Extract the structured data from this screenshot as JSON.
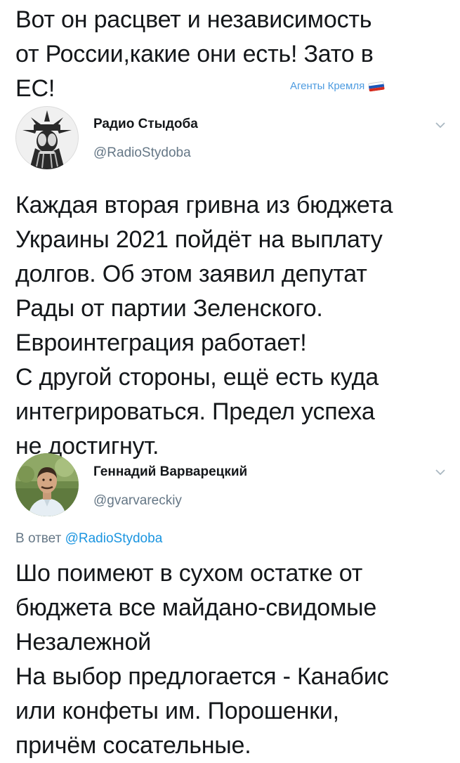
{
  "caption": "Вот он расцвет и независимость\nот России,какие они есть! Зато в\nЕС!",
  "watermark": {
    "text": "Агенты Кремля",
    "flag_colors": [
      "#ffffff",
      "#1c57b8",
      "#d52b1e"
    ]
  },
  "tweet1": {
    "author_name": "Радио Стыдоба",
    "handle": "@RadioStydoba",
    "text": "Каждая вторая гривна из бюджета\nУкраины 2021 пойдёт на выплату\nдолгов. Об этом заявил депутат\nРады от партии Зеленского.\nЕвроинтеграция работает!\nС другой стороны, ещё есть куда\nинтегрироваться. Предел успеха\nне достигнут."
  },
  "tweet2": {
    "author_name": "Геннадий Варварецкий",
    "handle": "@gvarvareckiy",
    "reply_prefix": "В ответ",
    "reply_handle": "@RadioStydoba",
    "text": "Шо поимеют в сухом остатке от\nбюджета все майдано-свидомые\nНезалежной\nНа выбор предлогается - Канабис\nили конфеты им. Порошенки,\nпричём сосательные."
  },
  "icons": {
    "menu": "chevron-down-icon",
    "avatar1": "statue-of-liberty-facepalm",
    "avatar2": "man-photo"
  },
  "colors": {
    "text": "#14171a",
    "muted": "#657786",
    "link": "#1b95e0",
    "watermark": "#4d9be0"
  }
}
